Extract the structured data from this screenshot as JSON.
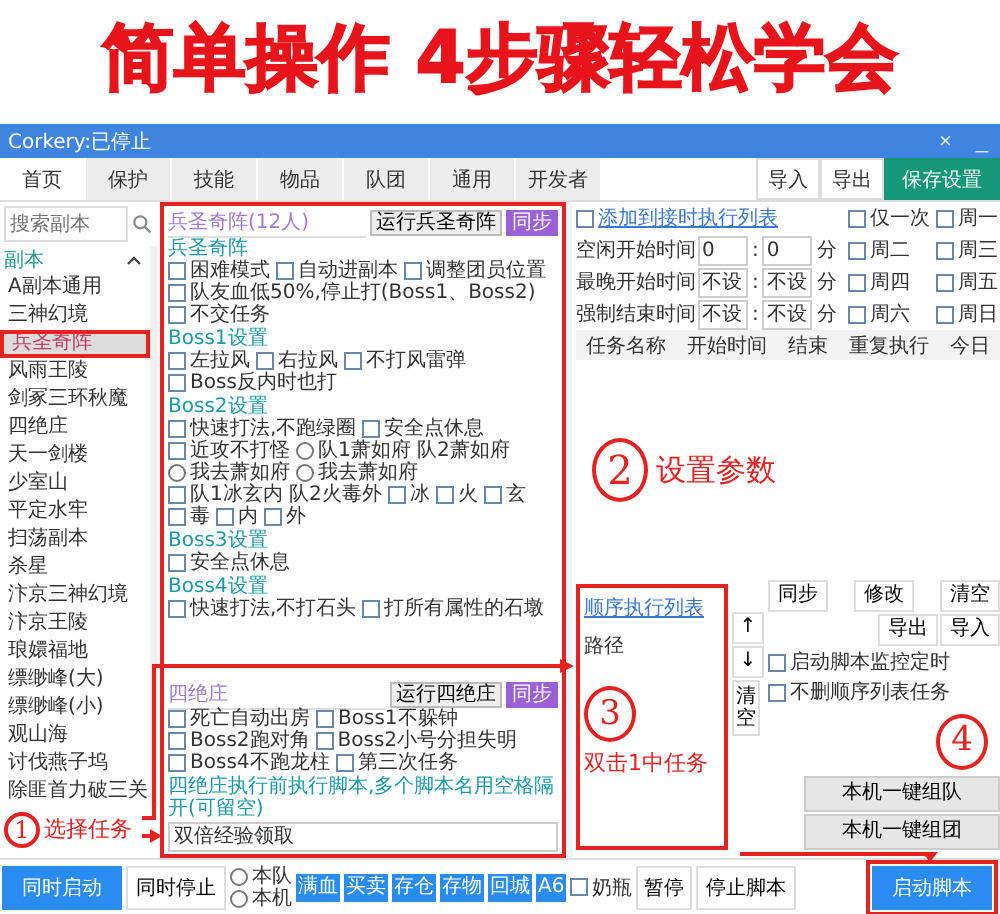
{
  "banner": {
    "title": "简单操作 4步骤轻松学会"
  },
  "window": {
    "title": "Corkery:已停止",
    "controls": [
      "×",
      "_"
    ]
  },
  "tabs": [
    {
      "label": "首页",
      "selected": true
    },
    {
      "label": "保护",
      "selected": false
    },
    {
      "label": "技能",
      "selected": false
    },
    {
      "label": "物品",
      "selected": false
    },
    {
      "label": "队团",
      "selected": false
    },
    {
      "label": "通用",
      "selected": false
    },
    {
      "label": "开发者",
      "selected": false
    }
  ],
  "toolbar": [
    {
      "label": "导入",
      "kind": "plain"
    },
    {
      "label": "导出",
      "kind": "plain"
    },
    {
      "label": "保存设置",
      "kind": "primary"
    }
  ],
  "sidebar": {
    "search": {
      "placeholder": "搜索副本"
    },
    "group": {
      "label": "副本",
      "expanded": true
    },
    "items": [
      {
        "label": "A副本通用",
        "selected": false
      },
      {
        "label": "三神幻境",
        "selected": false
      },
      {
        "label": "兵圣奇阵",
        "selected": true
      },
      {
        "label": "风雨王陵",
        "selected": false
      },
      {
        "label": "剑冢三环秋魔",
        "selected": false
      },
      {
        "label": "四绝庄",
        "selected": false
      },
      {
        "label": "天一剑楼",
        "selected": false
      },
      {
        "label": "少室山",
        "selected": false
      },
      {
        "label": "平定水牢",
        "selected": false
      },
      {
        "label": "扫荡副本",
        "selected": false
      },
      {
        "label": "杀星",
        "selected": false
      },
      {
        "label": "汴京三神幻境",
        "selected": false
      },
      {
        "label": "汴京王陵",
        "selected": false
      },
      {
        "label": "琅嬛福地",
        "selected": false
      },
      {
        "label": "缥缈峰(大)",
        "selected": false
      },
      {
        "label": "缥缈峰(小)",
        "selected": false
      },
      {
        "label": "观山海",
        "selected": false
      },
      {
        "label": "讨伐燕子坞",
        "selected": false
      },
      {
        "label": "除匪首力破三关",
        "selected": false
      }
    ]
  },
  "sections": [
    {
      "title": "兵圣奇阵(12人)",
      "run": "运行兵圣奇阵",
      "sync": "同步",
      "blocks": [
        {
          "heading": "兵圣奇阵",
          "options": [
            {
              "kind": "checkbox",
              "label": "困难模式",
              "checked": false
            },
            {
              "kind": "checkbox",
              "label": "自动进副本",
              "checked": false
            },
            {
              "kind": "checkbox",
              "label": "调整团员位置",
              "checked": false
            },
            {
              "kind": "checkbox",
              "label": "队友血低50%,停止打(Boss1、Boss2)",
              "checked": false
            },
            {
              "kind": "checkbox",
              "label": "不交任务",
              "checked": false
            }
          ]
        },
        {
          "heading": "Boss1设置",
          "options": [
            {
              "kind": "checkbox",
              "label": "左拉风",
              "checked": false
            },
            {
              "kind": "checkbox",
              "label": "右拉风",
              "checked": false
            },
            {
              "kind": "checkbox",
              "label": "不打风雷弹",
              "checked": false
            },
            {
              "kind": "checkbox",
              "label": "Boss反内时也打",
              "checked": false
            }
          ]
        },
        {
          "heading": "Boss2设置",
          "options": [
            {
              "kind": "checkbox",
              "label": "快速打法,不跑绿圈",
              "checked": false
            },
            {
              "kind": "checkbox",
              "label": "安全点休息",
              "checked": false
            },
            {
              "kind": "checkbox",
              "label": "近攻不打怪",
              "checked": false
            },
            {
              "kind": "radio",
              "label": "队1萧如府 队2萧如府",
              "selected": false
            },
            {
              "kind": "radio",
              "label": "我去萧如府",
              "selected": false
            },
            {
              "kind": "radio",
              "label": "我去萧如府",
              "selected": false
            },
            {
              "kind": "checkbox",
              "label": "队1冰玄内 队2火毒外",
              "checked": false
            },
            {
              "kind": "checkbox",
              "label": "冰",
              "checked": false
            },
            {
              "kind": "checkbox",
              "label": "火",
              "checked": false
            },
            {
              "kind": "checkbox",
              "label": "玄",
              "checked": false
            },
            {
              "kind": "checkbox",
              "label": "毒",
              "checked": false
            },
            {
              "kind": "checkbox",
              "label": "内",
              "checked": false
            },
            {
              "kind": "checkbox",
              "label": "外",
              "checked": false
            }
          ]
        },
        {
          "heading": "Boss3设置",
          "options": [
            {
              "kind": "checkbox",
              "label": "安全点休息",
              "checked": false
            }
          ]
        },
        {
          "heading": "Boss4设置",
          "options": [
            {
              "kind": "checkbox",
              "label": "快速打法,不打石头",
              "checked": false
            },
            {
              "kind": "checkbox",
              "label": "打所有属性的石墩",
              "checked": false
            }
          ]
        }
      ]
    },
    {
      "title": "四绝庄",
      "run": "运行四绝庄",
      "sync": "同步",
      "blocks": [
        {
          "options": [
            {
              "kind": "checkbox",
              "label": "死亡自动出房",
              "checked": false
            },
            {
              "kind": "checkbox",
              "label": "Boss1不躲钟",
              "checked": false
            },
            {
              "kind": "checkbox",
              "label": "Boss2跑对角",
              "checked": false
            },
            {
              "kind": "checkbox",
              "label": "Boss2小号分担失明",
              "checked": false
            },
            {
              "kind": "checkbox",
              "label": "Boss4不跑龙柱",
              "checked": false
            },
            {
              "kind": "checkbox",
              "label": "第三次任务",
              "checked": false
            }
          ]
        }
      ],
      "note": "四绝庄执行前执行脚本,多个脚本名用空格隔开(可留空)",
      "script_field": {
        "value": "双倍经验领取"
      }
    }
  ],
  "schedule": {
    "add_link": {
      "label": "添加到接时执行列表",
      "checked": false
    },
    "times": [
      {
        "label": "空闲开始时间",
        "hour": "0",
        "separator": ":",
        "minute": "0",
        "unit": "分"
      },
      {
        "label": "最晚开始时间",
        "hour": "不设",
        "separator": ":",
        "minute": "不设",
        "unit": "分"
      },
      {
        "label": "强制结束时间",
        "hour": "不设",
        "separator": ":",
        "minute": "不设",
        "unit": "分"
      }
    ],
    "days": [
      {
        "label": "仅一次",
        "checked": false
      },
      {
        "label": "周一",
        "checked": false
      },
      {
        "label": "周二",
        "checked": false
      },
      {
        "label": "周三",
        "checked": false
      },
      {
        "label": "周四",
        "checked": false
      },
      {
        "label": "周五",
        "checked": false
      },
      {
        "label": "周六",
        "checked": false
      },
      {
        "label": "周日",
        "checked": false
      }
    ],
    "columns": [
      "任务名称",
      "开始时间",
      "结束",
      "重复执行",
      "今日"
    ]
  },
  "sequence": {
    "title": "顺序执行列表",
    "items": [
      "路径"
    ],
    "sync": "同步",
    "edit": "修改",
    "clear": "清空",
    "export": "导出",
    "import": "导入",
    "up": "↑",
    "down": "↓",
    "clear_vertical": "清空",
    "options": [
      {
        "label": "启动脚本监控定时",
        "checked": false
      },
      {
        "label": "不删顺序列表任务",
        "checked": false
      }
    ],
    "team_buttons": [
      "本机一键组队",
      "本机一键组团"
    ]
  },
  "bottom": {
    "start_all": "同时启动",
    "stop_all": "同时停止",
    "targets": [
      {
        "label": "本队",
        "selected": false
      },
      {
        "label": "本机",
        "selected": false
      }
    ],
    "quick": [
      "满血",
      "买卖",
      "存仓",
      "存物",
      "回城",
      "A6"
    ],
    "milk": {
      "label": "奶瓶",
      "checked": false
    },
    "pause": "暂停",
    "stop": "停止脚本",
    "start": "启动脚本"
  },
  "annotations": [
    {
      "number": "1",
      "note": "选择任务"
    },
    {
      "number": "2",
      "note": "设置参数"
    },
    {
      "number": "3",
      "note": "双击1中任务"
    },
    {
      "number": "4"
    }
  ]
}
